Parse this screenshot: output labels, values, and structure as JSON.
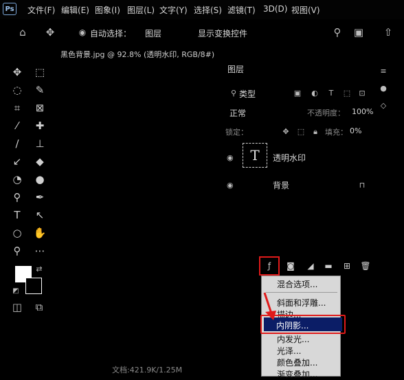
{
  "menubar": {
    "logo": "Ps",
    "items": [
      "文件(F)",
      "编辑(E)",
      "图象(I)",
      "图层(L)",
      "文字(Y)",
      "选择(S)",
      "滤镜(T)",
      "3D(D)",
      "视图(V)"
    ]
  },
  "options": {
    "auto_select_label": "自动选择：",
    "auto_select_value": "图层",
    "show_transform": "显示变换控件"
  },
  "document": {
    "tab_title": "黑色背景.jpg @ 92.8% (透明水印, RGB/8#)",
    "status_text": "文档:421.9K/1.25M"
  },
  "layers_panel": {
    "title": "图层",
    "filter_kind": "类型",
    "blend_mode": "正常",
    "opacity_label": "不透明度：",
    "opacity_value": "100%",
    "lock_label": "锁定：",
    "fill_label": "填充：",
    "fill_value": "0%",
    "layers": [
      {
        "name": "透明水印",
        "thumb": "T"
      },
      {
        "name": "背景"
      }
    ]
  },
  "fx_menu": {
    "items": [
      "混合选项...",
      "斜面和浮雕...",
      "描边...",
      "内阴影...",
      "内发光...",
      "光泽...",
      "颜色叠加...",
      "渐变叠加..."
    ],
    "selected": "内阴影..."
  },
  "colors": {
    "foreground": "#ffffff",
    "background": "#000000",
    "highlight": "#e01a1a",
    "selected_menu_bg": "#0b1d66"
  }
}
